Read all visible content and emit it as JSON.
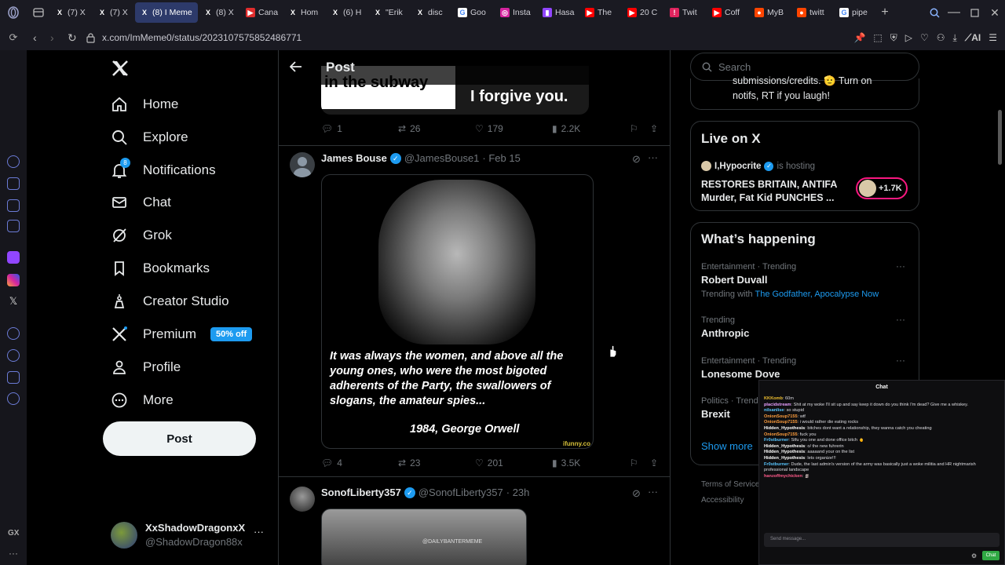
{
  "browser": {
    "tabs": [
      {
        "label": "(7) X",
        "icon": "x-favicon"
      },
      {
        "label": "(7) X",
        "icon": "x-favicon"
      },
      {
        "label": "(8) I Meme",
        "icon": "x-favicon",
        "active": true
      },
      {
        "label": "(8) X",
        "icon": "x-favicon"
      },
      {
        "label": "Cana",
        "icon": "play-favicon"
      },
      {
        "label": "Hom",
        "icon": "x-favicon"
      },
      {
        "label": "(6) H",
        "icon": "x-favicon"
      },
      {
        "label": "\"Erik",
        "icon": "x-favicon"
      },
      {
        "label": "disc",
        "icon": "x-favicon"
      },
      {
        "label": "Goo",
        "icon": "google-favicon"
      },
      {
        "label": "Insta",
        "icon": "instagram-favicon"
      },
      {
        "label": "Hasa",
        "icon": "twitch-favicon"
      },
      {
        "label": "The",
        "icon": "youtube-favicon"
      },
      {
        "label": "20 C",
        "icon": "youtube-favicon"
      },
      {
        "label": "Twit",
        "icon": "alert-favicon"
      },
      {
        "label": "Coff",
        "icon": "youtube-favicon"
      },
      {
        "label": "MyB",
        "icon": "reddit-favicon"
      },
      {
        "label": "twitt",
        "icon": "reddit-favicon"
      },
      {
        "label": "pipe",
        "icon": "google-favicon"
      }
    ],
    "url": "x.com/ImMeme0/status/2023107575852486771",
    "ai_label": "AI",
    "gx_label": "GX"
  },
  "nav": {
    "items": [
      {
        "label": "Home",
        "icon": "home-icon"
      },
      {
        "label": "Explore",
        "icon": "search-icon"
      },
      {
        "label": "Notifications",
        "icon": "bell-icon",
        "badge": "8"
      },
      {
        "label": "Chat",
        "icon": "mail-icon"
      },
      {
        "label": "Grok",
        "icon": "grok-icon"
      },
      {
        "label": "Bookmarks",
        "icon": "bookmark-icon"
      },
      {
        "label": "Creator Studio",
        "icon": "creator-icon"
      },
      {
        "label": "Premium",
        "icon": "x-logo-icon",
        "pill": "50% off"
      },
      {
        "label": "Profile",
        "icon": "person-icon"
      },
      {
        "label": "More",
        "icon": "more-icon"
      }
    ],
    "post_button": "Post",
    "account": {
      "name": "XxShadowDragonxX",
      "handle": "@ShadowDragon88x"
    }
  },
  "header": {
    "title": "Post"
  },
  "previous_tweet": {
    "image_text_left": "in the subway",
    "image_text_right": "I forgive you.",
    "replies": "1",
    "reposts": "26",
    "likes": "179",
    "views": "2.2K"
  },
  "tweet1": {
    "name": "James Bouse",
    "handle": "@JamesBouse1",
    "date": "· Feb 15",
    "quote": "It was always the women, and above all the young ones, who were the most bigoted adherents of the Party, the swallowers of slogans, the amateur spies...",
    "attribution": "1984, George Orwell",
    "watermark": "ifunny.co",
    "replies": "4",
    "reposts": "23",
    "likes": "201",
    "views": "3.5K"
  },
  "tweet2": {
    "name": "SonofLiberty357",
    "handle": "@SonofLiberty357",
    "date": "· 23h",
    "image_watermark": "@DAILYBANTERMEME"
  },
  "search": {
    "placeholder": "Search"
  },
  "top_card": {
    "line1": "submissions/credits. 🫡 Turn on",
    "line2": "notifs, RT if you laugh!"
  },
  "live": {
    "title": "Live on X",
    "host": "I,Hypocrite",
    "hosting": "is hosting",
    "headline": "RESTORES BRITAIN, ANTIFA Murder, Fat Kid PUNCHES ...",
    "listeners": "+1.7K"
  },
  "happening": {
    "title": "What’s happening",
    "trends": [
      {
        "meta": "Entertainment · Trending",
        "name": "Robert Duvall",
        "with_prefix": "Trending with",
        "with": "The Godfather, Apocalypse Now"
      },
      {
        "meta": "Trending",
        "name": "Anthropic"
      },
      {
        "meta": "Entertainment · Trending",
        "name": "Lonesome Dove"
      },
      {
        "meta": "Politics · Trend",
        "name": "Brexit"
      }
    ],
    "show_more": "Show more"
  },
  "footer": {
    "terms": "Terms of Service",
    "accessibility": "Accessibility"
  },
  "chat": {
    "title": "Chat",
    "messages": [
      {
        "user": "KKKomb",
        "text": ": 60m",
        "color": "#f0c030"
      },
      {
        "user": "placidstream",
        "text": ": Shit at my woke I'll sit up and say keep it down do you think I'm dead? Give me a whiskey.",
        "color": "#e8a0ff"
      },
      {
        "user": "nilsanlise",
        "text": ": so stupid",
        "color": "#59c6ff"
      },
      {
        "user": "OnionSoup7155",
        "text": ": wtf",
        "color": "#ff9e3d"
      },
      {
        "user": "OnionSoup7155",
        "text": ": i would rather die eating rocks",
        "color": "#ff9e3d"
      },
      {
        "user": "Hidden_Hypothesis",
        "text": ": bitches dont want a relationship, they wanna catch you cheating",
        "color": "#ffffff"
      },
      {
        "user": "OnionSoup7155",
        "text": ": fuck you",
        "color": "#ff9e3d"
      },
      {
        "user": "Fr0stburner",
        "text": ": Stfu you one and done office bitch 🖕",
        "color": "#59c6ff"
      },
      {
        "user": "Hidden_Hypothesis",
        "text": ": o/ the new fuhrerin",
        "color": "#ffffff"
      },
      {
        "user": "Hidden_Hypothesis",
        "text": ": aaaaand your on the list",
        "color": "#ffffff"
      },
      {
        "user": "Hidden_Hypothesis",
        "text": ": lets organize!!!",
        "color": "#ffffff"
      },
      {
        "user": "Fr0stburner",
        "text": ": Dude, the last admin's version of the army was basically just a woke militia and HR nightmarish",
        "color": "#59c6ff"
      },
      {
        "user": "",
        "text": "professional landscape",
        "color": "#dedee3"
      },
      {
        "user": "hanzoffmychicken",
        "text": ": 🗿",
        "color": "#ff5a8a"
      }
    ],
    "input_placeholder": "Send message...",
    "send_label": "Chat"
  },
  "colors": {
    "accent": "#1d9bf0",
    "live_ring": "#f91880",
    "link": "#1d9bf0"
  }
}
